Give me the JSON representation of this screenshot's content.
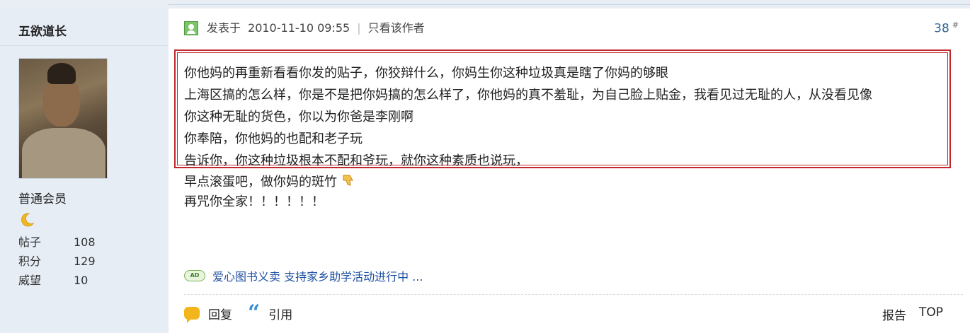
{
  "author": {
    "name": "五欲道长",
    "group": "普通会员",
    "stats": [
      {
        "label": "帖子",
        "value": "108"
      },
      {
        "label": "积分",
        "value": "129"
      },
      {
        "label": "威望",
        "value": "10"
      }
    ]
  },
  "post": {
    "posted_prefix": "发表于",
    "posted_time": "2010-11-10 09:55",
    "only_author": "只看该作者",
    "floor": "38",
    "floor_mark": "#",
    "lines": [
      "你他妈的再重新看看你发的贴子，你狡辩什么，你妈生你这种垃圾真是瞎了你妈的够眼",
      "上海区搞的怎么样，你是不是把你妈搞的怎么样了，你他妈的真不羞耻，为自己脸上贴金，我看见过无耻的人，从没看见像",
      "你这种无耻的货色，你以为你爸是李刚啊",
      "你奉陪，你他妈的也配和老子玩",
      "告诉你，你这种垃圾根本不配和爷玩，就你这种素质也说玩，"
    ],
    "extra_lines": [
      "早点滚蛋吧，做你妈的斑竹",
      "再咒你全家！！！！！！"
    ]
  },
  "ad": {
    "badge": "AD",
    "text": "爱心图书义卖  支持家乡助学活动进行中 ..."
  },
  "footer": {
    "reply": "回复",
    "quote": "引用",
    "report": "报告",
    "top": "TOP"
  },
  "colors": {
    "sidebar_bg": "#e6edf5",
    "highlight_border": "#c0282d",
    "link_blue": "#1d4fa0"
  }
}
